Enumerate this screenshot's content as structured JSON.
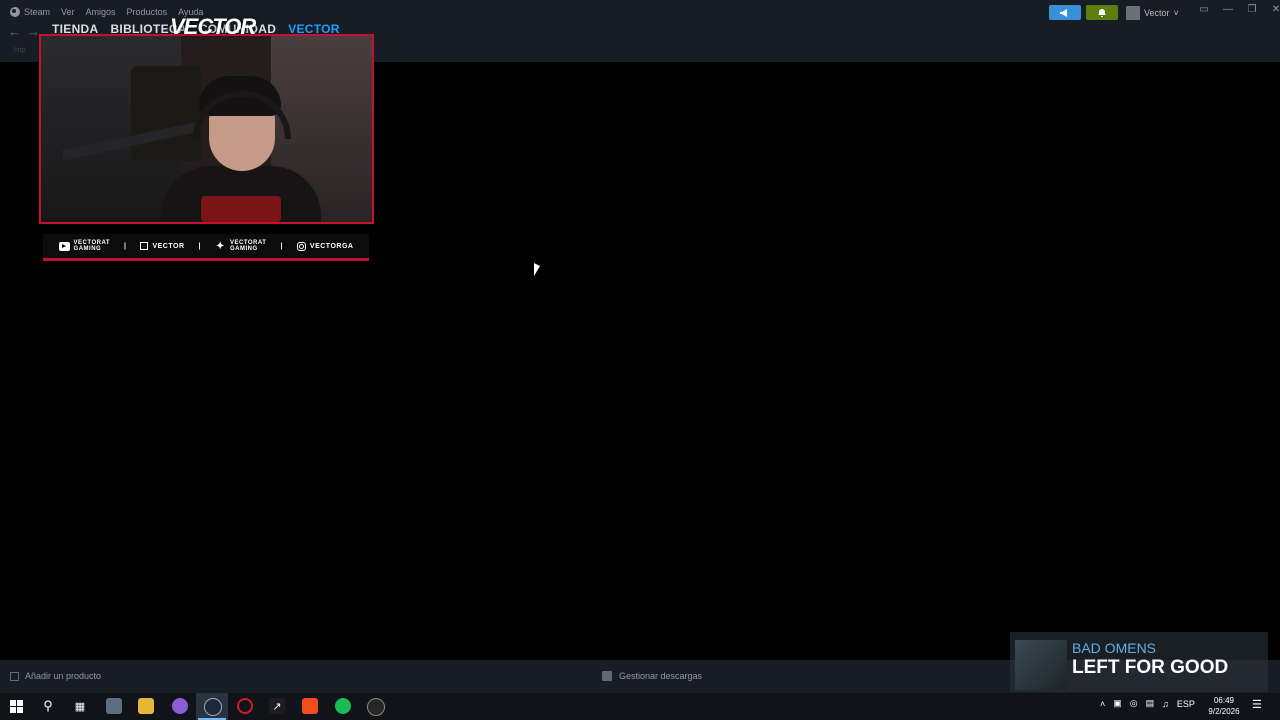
{
  "steam": {
    "menu": [
      "Steam",
      "Ver",
      "Amigos",
      "Productos",
      "Ayuda"
    ],
    "tabs": [
      {
        "label": "TIENDA",
        "active": false
      },
      {
        "label": "BIBLIOTECA",
        "active": false
      },
      {
        "label": "COMUNIDAD",
        "active": false
      },
      {
        "label": "VECTOR",
        "active": true
      }
    ],
    "url_hint": "http",
    "user_name": "Vector",
    "footer": {
      "add_product": "Añadir un producto",
      "manage_downloads": "Gestionar descargas"
    },
    "colors": {
      "accent": "#1a9fff",
      "announce": "#3a8fd9",
      "notify": "#5c7e10",
      "bg": "#171d25"
    }
  },
  "stream_overlay": {
    "logo_text": "VECTOR",
    "frame_color": "#c8102e",
    "socials": [
      {
        "icon": "youtube-icon",
        "line1": "VECTORAT",
        "line2": "GAMING"
      },
      {
        "icon": "twitch-icon",
        "line1": "VECTOR",
        "line2": ""
      },
      {
        "icon": "twitter-icon",
        "line1": "VECTORAT",
        "line2": "GAMING"
      },
      {
        "icon": "instagram-icon",
        "line1": "VECTORGA",
        "line2": ""
      }
    ],
    "now_playing": {
      "artist": "BAD OMENS",
      "title": "LEFT FOR GOOD"
    }
  },
  "taskbar": {
    "apps": [
      "file-explorer-icon",
      "folder-icon",
      "chrome-icon",
      "steam-icon",
      "opera-icon",
      "epic-icon",
      "brave-icon",
      "spotify-icon",
      "obs-icon"
    ],
    "language": "ESP",
    "time": "06:49",
    "date": "9/2/2026",
    "notifications": "3"
  }
}
